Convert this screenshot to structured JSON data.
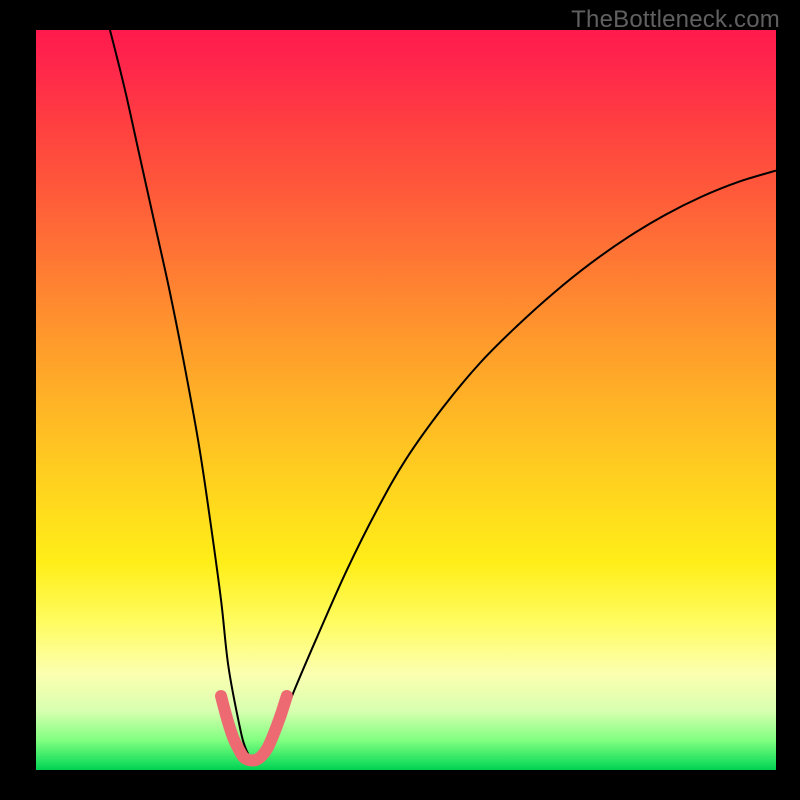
{
  "watermark": "TheBottleneck.com",
  "chart_data": {
    "type": "line",
    "title": "",
    "xlabel": "",
    "ylabel": "",
    "xlim": [
      0,
      100
    ],
    "ylim": [
      0,
      100
    ],
    "background_gradient": {
      "top_color": "#ff1a4d",
      "mid_color": "#ffee18",
      "bottom_color": "#00d050"
    },
    "series": [
      {
        "name": "v-curve",
        "stroke": "#000000",
        "stroke_width": 2,
        "x": [
          10,
          12,
          14,
          16,
          18,
          20,
          22,
          23.5,
          25,
          26,
          27.5,
          28.3,
          29.2,
          30.2,
          31.5,
          33,
          35,
          38,
          42,
          46,
          50,
          55,
          60,
          65,
          70,
          75,
          80,
          85,
          90,
          95,
          100
        ],
        "values": [
          100,
          92,
          83,
          74,
          65,
          55,
          44,
          34,
          23,
          14,
          6,
          3,
          1.5,
          1.5,
          3,
          6,
          11,
          18,
          27,
          35,
          42,
          49,
          55,
          60,
          64.5,
          68.5,
          72,
          75,
          77.5,
          79.5,
          81
        ]
      },
      {
        "name": "u-highlight",
        "stroke": "#ed6a72",
        "stroke_width": 12,
        "linecap": "round",
        "x": [
          25.0,
          25.8,
          26.6,
          27.4,
          28.0,
          28.6,
          29.2,
          29.8,
          30.5,
          31.3,
          32.1,
          33.0,
          33.9
        ],
        "values": [
          10.0,
          7.0,
          4.5,
          2.8,
          1.8,
          1.4,
          1.3,
          1.4,
          1.9,
          3.0,
          4.8,
          7.2,
          10.0
        ]
      }
    ]
  }
}
